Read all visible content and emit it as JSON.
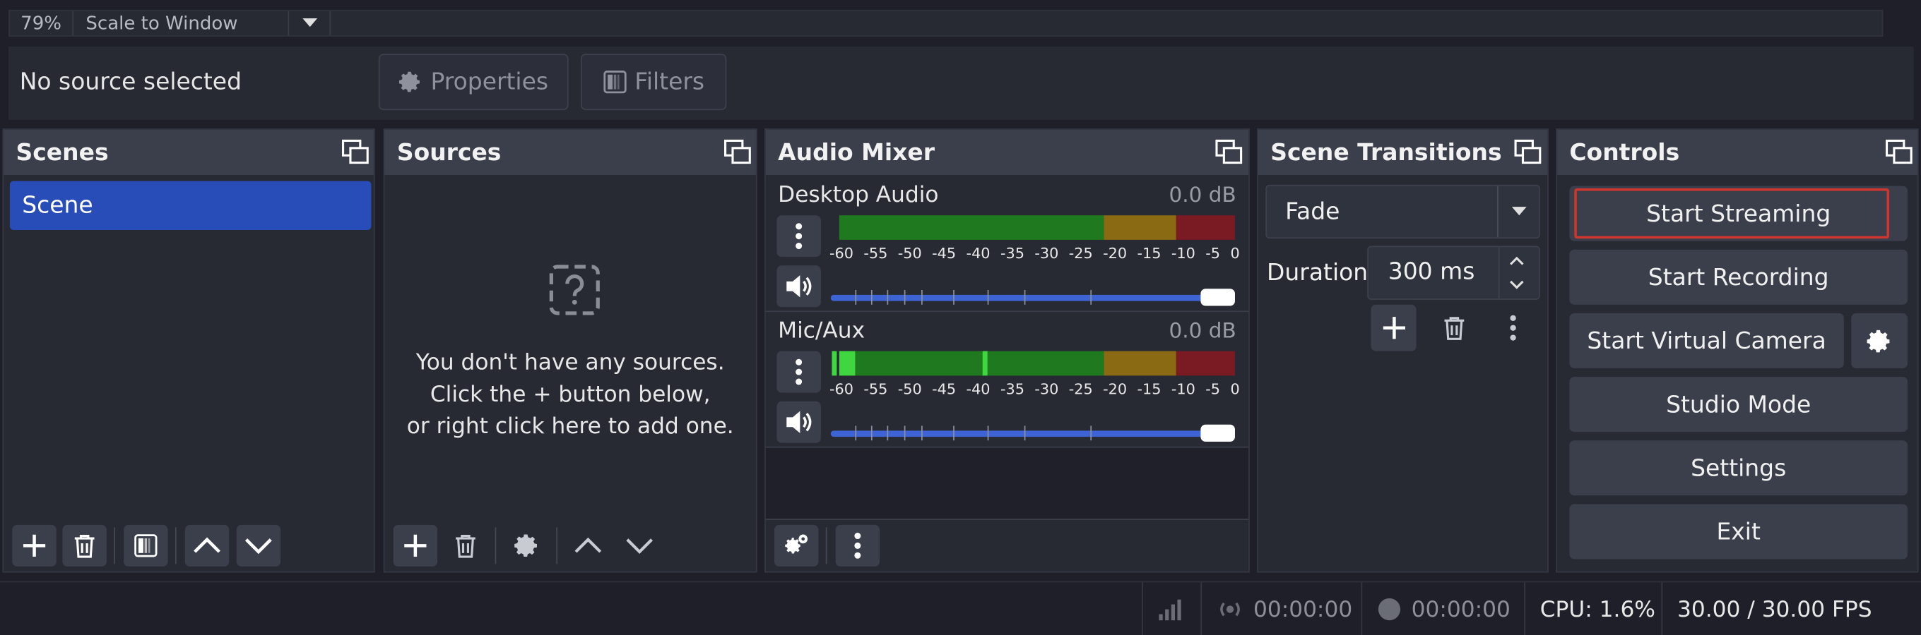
{
  "zoom": {
    "percent": "79%",
    "mode": "Scale to Window"
  },
  "source_bar": {
    "status": "No source selected",
    "properties_label": "Properties",
    "filters_label": "Filters"
  },
  "scenes": {
    "title": "Scenes",
    "items": [
      "Scene"
    ]
  },
  "sources": {
    "title": "Sources",
    "empty_line1": "You don't have any sources.",
    "empty_line2": "Click the + button below,",
    "empty_line3": "or right click here to add one."
  },
  "audio_mixer": {
    "title": "Audio Mixer",
    "scale_ticks": [
      "-60",
      "-55",
      "-50",
      "-45",
      "-40",
      "-35",
      "-30",
      "-25",
      "-20",
      "-15",
      "-10",
      "-5",
      "0"
    ],
    "channels": [
      {
        "name": "Desktop Audio",
        "level": "0.0 dB",
        "volume_fraction": 1.0
      },
      {
        "name": "Mic/Aux",
        "level": "0.0 dB",
        "volume_fraction": 1.0
      }
    ]
  },
  "scene_transitions": {
    "title": "Scene Transitions",
    "selected": "Fade",
    "duration_label": "Duration",
    "duration_value": "300 ms"
  },
  "controls": {
    "title": "Controls",
    "start_streaming": "Start Streaming",
    "start_recording": "Start Recording",
    "start_virtual_camera": "Start Virtual Camera",
    "studio_mode": "Studio Mode",
    "settings": "Settings",
    "exit": "Exit"
  },
  "status_bar": {
    "stream_time": "00:00:00",
    "record_time": "00:00:00",
    "cpu": "CPU: 1.6%",
    "fps": "30.00 / 30.00 FPS"
  },
  "colors": {
    "accent": "#284cb8",
    "slider": "#3d63d4",
    "meter_green": "#1f7a1f",
    "meter_yellow": "#8a6a12",
    "meter_red": "#7a1a22",
    "focus_border": "#d0352e"
  }
}
